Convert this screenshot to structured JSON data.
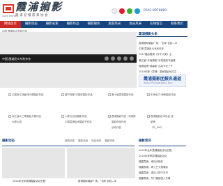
{
  "header": {
    "logo_text": "霞浦摄影",
    "logo_en": "XIAPU PHOTO",
    "site_title": "霞浦掮影",
    "subtitle": "霞浦县摄影家协会",
    "phone": "0593-8979880",
    "social_icons": [
      "qq-icon",
      "weibo-icon",
      "wechat-icon",
      "tencent-weibo-icon",
      "mail-icon"
    ]
  },
  "nav": {
    "items": [
      {
        "label": "网站首页",
        "active": true
      },
      {
        "label": "摄影动态"
      },
      {
        "label": "摄影名家"
      },
      {
        "label": "摄影作品"
      },
      {
        "label": "摄影服务"
      },
      {
        "label": "旅游风光"
      },
      {
        "label": "会员风采"
      },
      {
        "label": "在线留言"
      },
      {
        "label": "联系我们"
      }
    ]
  },
  "breadcrumb": "中国 霞浦民众专利作作",
  "banner": {
    "caption": "中国 霞浦民众专利作作"
  },
  "side_news": {
    "title": "霞浦摄影头条",
    "items": [
      "霞浦国际摄影广场，“百年·百姓—中",
      "中国·霞浦民众专利作作",
      "2017福由霞浦《东宁大美》主",
      "第五届“东海第韵”手机摄影书画展",
      "霞浦县第“观摄影”活动节在三千",
      "2019年第（霞浦）国家摄影地文文"
    ]
  },
  "promo": {
    "title": "霞浦摄影团报名通道",
    "subtitle": "Xiapu Photography Tour"
  },
  "grid": [
    {
      "text": "中国浙江钱塘·第1期摄影作品"
    },
    {
      "text": "春节特集·中国家摄影作品"
    },
    {
      "text": "第十届霞浦摄影作品"
    },
    {
      "text": "东海全力·海峡摄影作品"
    },
    {
      "text": "浙江省长三角摄影大赛作品"
    },
    {
      "text": "大赛公费"
    },
    {
      "text": "中国霞浦民间摄影节作品"
    },
    {
      "text": "人类与自然摄影作品"
    },
    {
      "text": "霞浦摄影作品（科美陈"
    },
    {
      "text": "霞浦摄影技术协会·连"
    },
    {
      "text": "摄影获奖作品"
    },
    {
      "text": "中国网合作"
    },
    {
      "text": "繁荣"
    },
    {
      "text": "活动作品"
    },
    {
      "text": "（叶_500）"
    }
  ],
  "sections": {
    "left_title": "摄影动态",
    "tabs": [
      "新闻动态",
      "摄影活动",
      "协会动态",
      "摄影作品"
    ],
    "right_title": "摄影资讯",
    "photo1_caption": "2025年全年霞浦摄影活动日程",
    "photo2_caption": "霞浦国际摄影广场，“百年·百姓—中",
    "news_items": [
      "2025年全年霞浦摄影活动日程",
      "2025年夏季霞浦摄影活动",
      "福建霞浦，滩涂光影的",
      "福建霞浦，海上巴大美摄影",
      "福建霞浦，滩涂上的千古光",
      "福建霞浦，东门摄影团入东楼"
    ]
  }
}
